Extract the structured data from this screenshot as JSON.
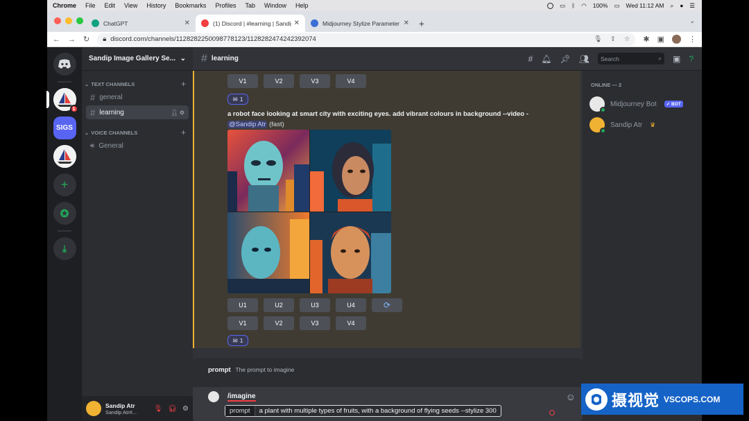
{
  "menubar": {
    "items": [
      "Chrome",
      "File",
      "Edit",
      "View",
      "History",
      "Bookmarks",
      "Profiles",
      "Tab",
      "Window",
      "Help"
    ],
    "battery": "100%",
    "clock": "Wed 11:12 AM"
  },
  "browser": {
    "tabs": [
      {
        "title": "ChatGPT"
      },
      {
        "title": "(1) Discord | #learning | Sandip"
      },
      {
        "title": "Midjourney Stylize Parameter"
      }
    ],
    "url": "discord.com/channels/1128282250098778123/1128282474242392074"
  },
  "servers": {
    "sigs_label": "SIGS",
    "badge_count": "1"
  },
  "sidebar": {
    "server_name": "Sandip Image Gallery Se...",
    "text_category": "TEXT CHANNELS",
    "text_channels": [
      "general",
      "learning"
    ],
    "voice_category": "VOICE CHANNELS",
    "voice_channels": [
      "General"
    ]
  },
  "user": {
    "name": "Sandip Atr",
    "tag": "Sandip Atr#..."
  },
  "channel": {
    "name": "learning",
    "search_placeholder": "Search"
  },
  "messages": {
    "top_variations": [
      "V1",
      "V2",
      "V3",
      "V4"
    ],
    "top_reaction": "1",
    "prompt": "a robot face looking at smart city with exciting eyes. add vibrant colours in background --video -",
    "mention": "@Sandip Atr",
    "speed": "(fast)",
    "upscales": [
      "U1",
      "U2",
      "U3",
      "U4"
    ],
    "variations": [
      "V1",
      "V2",
      "V3",
      "V4"
    ],
    "reaction": "1"
  },
  "command": {
    "option_name": "prompt",
    "option_desc": "The prompt to imagine",
    "slash": "/imagine",
    "field_label": "prompt",
    "field_value": "a plant with multiple types of fruits, with a background of flying seeds --stylize 300"
  },
  "members": {
    "header": "ONLINE — 2",
    "list": [
      {
        "name": "Midjourney Bot",
        "badge": "✓ BOT"
      },
      {
        "name": "Sandip Atr"
      }
    ]
  },
  "watermark": {
    "zh": "摄视觉",
    "en": "VSCOPS.COM"
  },
  "colors": {
    "blurple": "#5865f2",
    "online": "#23a55a",
    "mention_highlight": "#f0b232"
  }
}
